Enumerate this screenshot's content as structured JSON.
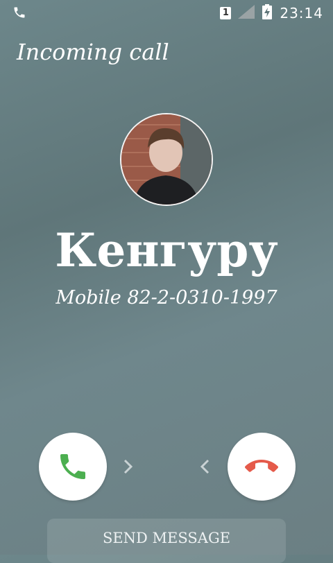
{
  "status_bar": {
    "time": "23:14",
    "sim_label": "1",
    "icons": [
      "phone-icon",
      "sim-icon",
      "signal-icon",
      "battery-charging-icon"
    ]
  },
  "header": {
    "title": "Incoming call"
  },
  "caller": {
    "name": "Кенгуру",
    "number": "Mobile 82-2-0310-1997"
  },
  "actions": {
    "answer_color": "#4caf50",
    "decline_color": "#e55a4a",
    "send_message_label": "SEND MESSAGE"
  }
}
